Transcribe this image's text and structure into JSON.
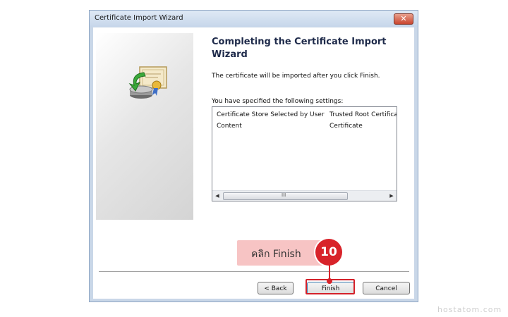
{
  "window": {
    "title": "Certificate Import Wizard",
    "close_glyph": "✕"
  },
  "wizard": {
    "heading": "Completing the Certificate Import Wizard",
    "description": "The certificate will be imported after you click Finish.",
    "settings_label": "You have specified the following settings:",
    "settings_rows": [
      {
        "name": "Certificate Store Selected by User",
        "value": "Trusted Root Certifica"
      },
      {
        "name": "Content",
        "value": "Certificate"
      }
    ],
    "scroll_left": "◀",
    "scroll_right": "▶",
    "scroll_grip": "III"
  },
  "buttons": {
    "back": "< Back",
    "finish": "Finish",
    "cancel": "Cancel"
  },
  "annotation": {
    "callout_text": "คลิก Finish",
    "step_number": "10",
    "color": "#d8232a"
  },
  "watermark": "hostatom.com",
  "icons": [
    "certificate-import-icon",
    "close-icon"
  ]
}
